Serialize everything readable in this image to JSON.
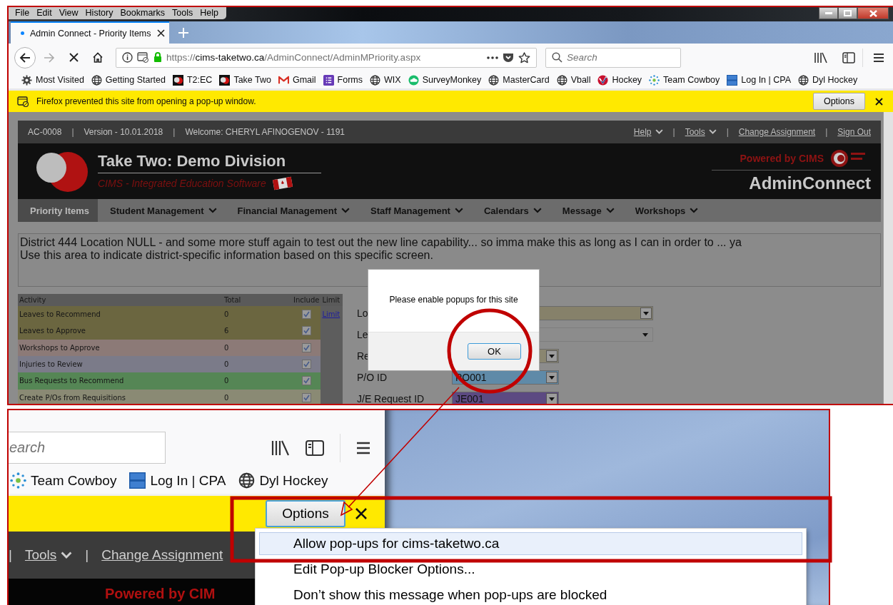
{
  "menu_bar": [
    "File",
    "Edit",
    "View",
    "History",
    "Bookmarks",
    "Tools",
    "Help"
  ],
  "tab": {
    "title": "Admin Connect - Priority Items"
  },
  "address_bar": {
    "scheme": "https://",
    "host": "cims-taketwo.ca",
    "path": "/AdminConnect/AdminMPriority.aspx"
  },
  "search": {
    "placeholder": "Search"
  },
  "bookmarks": [
    "Most Visited",
    "Getting Started",
    "T2:EC",
    "Take Two",
    "Gmail",
    "Forms",
    "WIX",
    "SurveyMonkey",
    "MasterCard",
    "Vball",
    "Hockey",
    "Team Cowboy",
    "Log In | CPA",
    "Dyl Hockey"
  ],
  "notification": {
    "message": "Firefox prevented this site from opening a pop-up window.",
    "button": "Options"
  },
  "page": {
    "info_bar": [
      {
        "kind": "text",
        "label": "AC-0008"
      },
      {
        "kind": "separator",
        "label": "|"
      },
      {
        "kind": "text",
        "label": "Version - 10.01.2018"
      },
      {
        "kind": "separator",
        "label": "|"
      },
      {
        "kind": "text",
        "label": "Welcome: CHERYL AFINOGENOV - 1191"
      }
    ],
    "header_links": [
      {
        "kind": "menu",
        "label": "Help"
      },
      {
        "kind": "separator",
        "label": "|"
      },
      {
        "kind": "menu",
        "label": "Tools"
      },
      {
        "kind": "separator",
        "label": "|"
      },
      {
        "kind": "link",
        "label": "Change Assignment"
      },
      {
        "kind": "separator",
        "label": "|"
      },
      {
        "kind": "link",
        "label": "Sign Out"
      }
    ],
    "title": "Take Two: Demo Division",
    "subtitle": "CIMS - Integrated Education Software",
    "powered_by": "Powered by CIMS",
    "product": "AdminConnect",
    "nav": [
      {
        "label": "Priority Items",
        "selected": true,
        "dropdown": false
      },
      {
        "label": "Student Management",
        "selected": false,
        "dropdown": true
      },
      {
        "label": "Financial Management",
        "selected": false,
        "dropdown": true
      },
      {
        "label": "Staff Management",
        "selected": false,
        "dropdown": true
      },
      {
        "label": "Calendars",
        "selected": false,
        "dropdown": true
      },
      {
        "label": "Message",
        "selected": false,
        "dropdown": true
      },
      {
        "label": "Workshops",
        "selected": false,
        "dropdown": true
      }
    ],
    "notice": [
      "District 444 Location NULL - and some more stuff again to test out the new line capability... so imma make this as long as I can in order to ... ya",
      "Use this area to indicate district-specific information based on this specific screen."
    ],
    "activity_table": {
      "columns": [
        "Activity",
        "Total",
        "Include",
        "Limit"
      ],
      "rows": [
        {
          "activity": "Leaves to Recommend",
          "total": "0",
          "include": true,
          "limit": "Limit",
          "color": "#6b6640"
        },
        {
          "activity": "Leaves to Approve",
          "total": "6",
          "include": true,
          "color": "#6b6640"
        },
        {
          "activity": "Workshops to Approve",
          "total": "0",
          "include": true,
          "color": "#8c7a77"
        },
        {
          "activity": "Injuries to Review",
          "total": "0",
          "include": true,
          "color": "#7b7b89"
        },
        {
          "activity": "Bus Requests to Recommend",
          "total": "0",
          "include": true,
          "color": "#558655"
        },
        {
          "activity": "Create P/Os from Requisitions",
          "total": "0",
          "include": true,
          "color": "#8a8a74"
        }
      ]
    },
    "fields": [
      {
        "label": "Lo",
        "kind": "dropdown",
        "color": "#86816a"
      },
      {
        "label": "Le",
        "kind": "select",
        "color": "#8c8c8c"
      },
      {
        "label": "Re",
        "kind": "dropdown",
        "color": "#8a8670"
      },
      {
        "label": "P/O ID",
        "kind": "dropdown",
        "value": "PO001",
        "color": "#5f8aa8"
      },
      {
        "label": "J/E Request ID",
        "kind": "dropdown",
        "value": "JE001",
        "color": "#5c4a82"
      }
    ]
  },
  "dialog": {
    "message": "Please enable popups for this site",
    "button": "OK"
  },
  "inset": {
    "search": {
      "placeholder": "earch"
    },
    "bookmarks": [
      "Team Cowboy",
      "Log In | CPA",
      "Dyl Hockey"
    ],
    "notification": {
      "button": "Options"
    },
    "header_links": [
      {
        "kind": "separator",
        "label": "|"
      },
      {
        "kind": "menu",
        "label": "Tools"
      },
      {
        "kind": "separator",
        "label": "|"
      },
      {
        "kind": "link",
        "label": "Change Assignment"
      }
    ],
    "powered_by": "Powered by CIM",
    "popup_menu": [
      {
        "label": "Allow pop-ups for cims-taketwo.ca",
        "selected": true
      },
      {
        "label": "Edit Pop-up Blocker Options...",
        "selected": false
      },
      {
        "label": "Don’t show this message when pop-ups are blocked",
        "selected": false
      }
    ]
  }
}
